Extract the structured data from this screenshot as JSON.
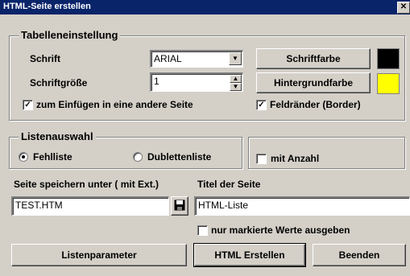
{
  "window": {
    "title": "HTML-Seite erstellen",
    "close_glyph": "✕"
  },
  "tabelleneinstellung": {
    "legend": "Tabelleneinstellung",
    "schrift_label": "Schrift",
    "schrift_value": "ARIAL",
    "schriftgroesse_label": "Schriftgröße",
    "schriftgroesse_value": "1",
    "schriftfarbe_button": "Schriftfarbe",
    "schriftfarbe_color": "#000000",
    "hintergrundfarbe_button": "Hintergrundfarbe",
    "hintergrundfarbe_color": "#ffff00",
    "einfuegen_label": "zum Einfügen in eine andere Seite",
    "einfuegen_checked": true,
    "feldraender_label": "Feldränder (Border)",
    "feldraender_checked": true
  },
  "listenauswahl": {
    "legend": "Listenauswahl",
    "options": [
      {
        "label": "Fehlliste",
        "selected": true
      },
      {
        "label": "Dublettenliste",
        "selected": false
      }
    ]
  },
  "mit_anzahl": {
    "label": "mit Anzahl",
    "checked": false
  },
  "speichern": {
    "label": "Seite speichern unter ( mit Ext.)",
    "value": "TEST.HTM",
    "save_icon": "floppy-disk-icon"
  },
  "titel": {
    "label": "Titel der Seite",
    "value": "HTML-Liste"
  },
  "nur_markierte": {
    "label": "nur markierte Werte ausgeben",
    "checked": false
  },
  "buttons": {
    "listenparameter": "Listenparameter",
    "html_erstellen": "HTML Erstellen",
    "beenden": "Beenden"
  }
}
